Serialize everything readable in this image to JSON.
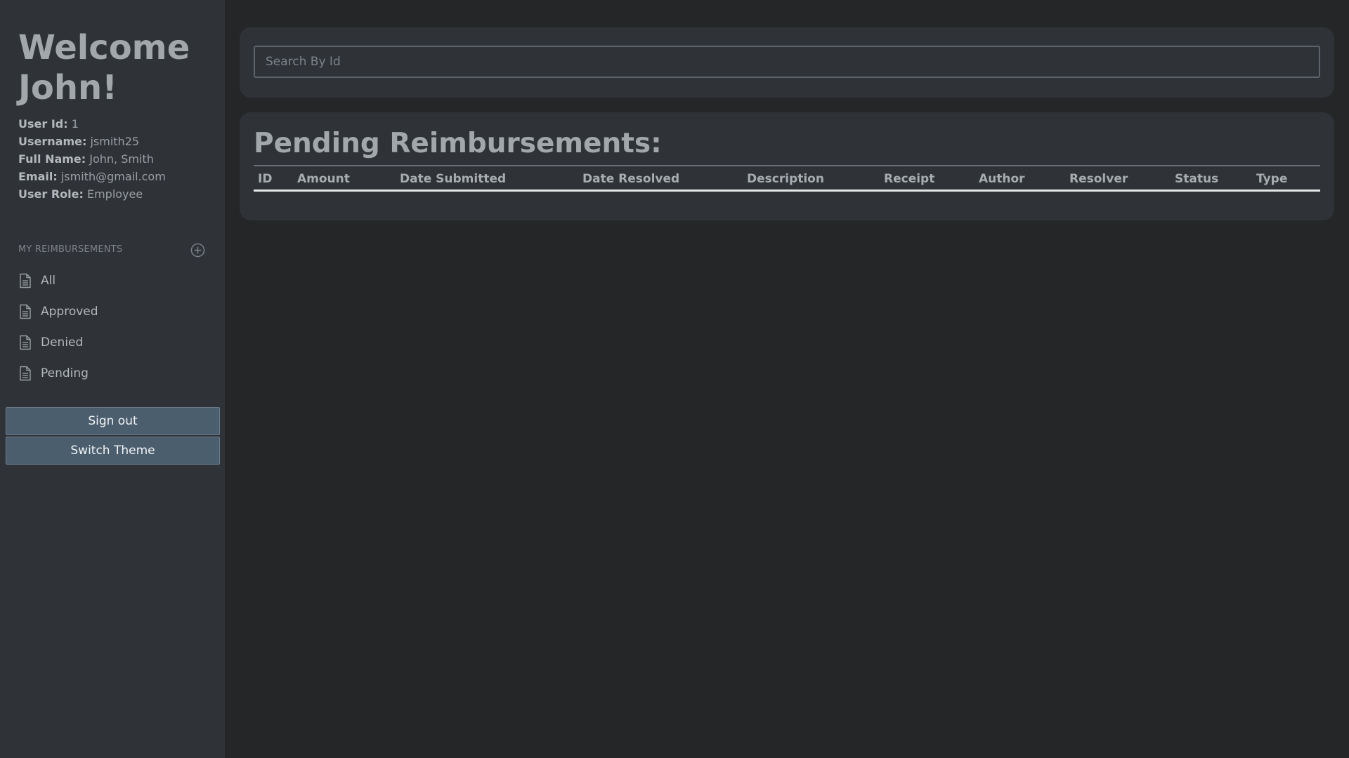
{
  "sidebar": {
    "welcome": "Welcome John!",
    "user_info": [
      {
        "label": "User Id:",
        "value": "1"
      },
      {
        "label": "Username:",
        "value": "jsmith25"
      },
      {
        "label": "Full Name:",
        "value": "John, Smith"
      },
      {
        "label": "Email:",
        "value": "jsmith@gmail.com"
      },
      {
        "label": "User Role:",
        "value": "Employee"
      }
    ],
    "section_title": "MY REIMBURSEMENTS",
    "add_icon": "plus-circle-icon",
    "nav_items": [
      {
        "label": "All",
        "icon": "document-icon"
      },
      {
        "label": "Approved",
        "icon": "document-icon"
      },
      {
        "label": "Denied",
        "icon": "document-icon"
      },
      {
        "label": "Pending",
        "icon": "document-icon"
      }
    ],
    "sign_out_label": "Sign out",
    "switch_theme_label": "Switch Theme"
  },
  "search": {
    "placeholder": "Search By Id",
    "value": ""
  },
  "table": {
    "title": "Pending Reimbursements:",
    "columns": [
      "ID",
      "Amount",
      "Date Submitted",
      "Date Resolved",
      "Description",
      "Receipt",
      "Author",
      "Resolver",
      "Status",
      "Type"
    ],
    "rows": []
  },
  "colors": {
    "background": "#242627",
    "panel": "#2f3237",
    "button": "#4b5e6e",
    "text": "#a2a7ab"
  }
}
